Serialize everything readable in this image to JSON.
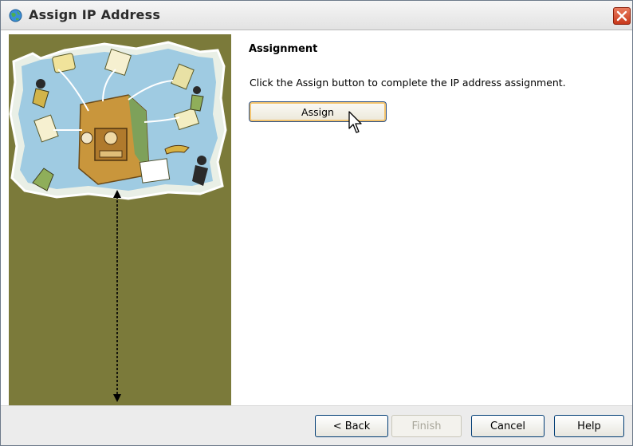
{
  "window": {
    "title": "Assign IP Address",
    "app_icon": "globe-icon",
    "close_icon": "close-icon"
  },
  "wizard": {
    "heading": "Assignment",
    "instruction": "Click the Assign button to complete the IP address assignment.",
    "assign_label": "Assign"
  },
  "illustration": {
    "icon": "collage-illustration",
    "marker": "double-headed-arrow-icon"
  },
  "footer": {
    "back_label": "< Back",
    "finish_label": "Finish",
    "finish_enabled": false,
    "cancel_label": "Cancel",
    "help_label": "Help"
  },
  "colors": {
    "panel": "#7b7a3a",
    "close": "#d9502f",
    "focus_ring": "#f3c46f"
  }
}
